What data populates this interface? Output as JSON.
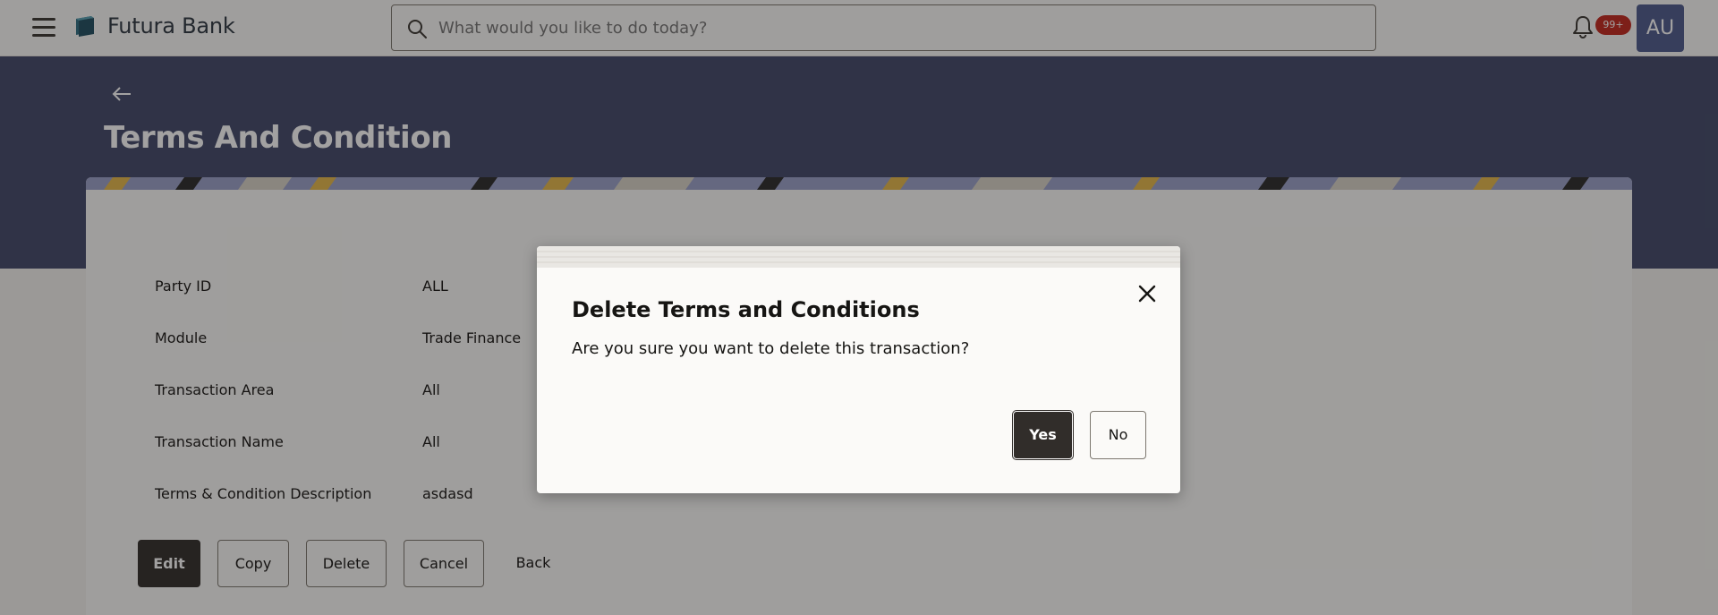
{
  "header": {
    "app_name": "Futura Bank",
    "search_placeholder": "What would you like to do today?",
    "notification_count": "99+",
    "avatar_initials": "AU"
  },
  "page": {
    "title": "Terms And Condition"
  },
  "details": [
    {
      "label": "Party ID",
      "value": "ALL"
    },
    {
      "label": "Module",
      "value": "Trade Finance"
    },
    {
      "label": "Transaction Area",
      "value": "All"
    },
    {
      "label": "Transaction Name",
      "value": "All"
    },
    {
      "label": "Terms & Condition Description",
      "value": "asdasd"
    }
  ],
  "actions": {
    "edit": "Edit",
    "copy": "Copy",
    "delete": "Delete",
    "cancel": "Cancel",
    "back": "Back"
  },
  "dialog": {
    "title": "Delete Terms and Conditions",
    "message": "Are you sure you want to delete this transaction?",
    "yes": "Yes",
    "no": "No"
  },
  "colors": {
    "banner": "#41496a",
    "primary_button": "#312d2a",
    "badge": "#c2271d",
    "avatar": "#4d5a8c"
  }
}
